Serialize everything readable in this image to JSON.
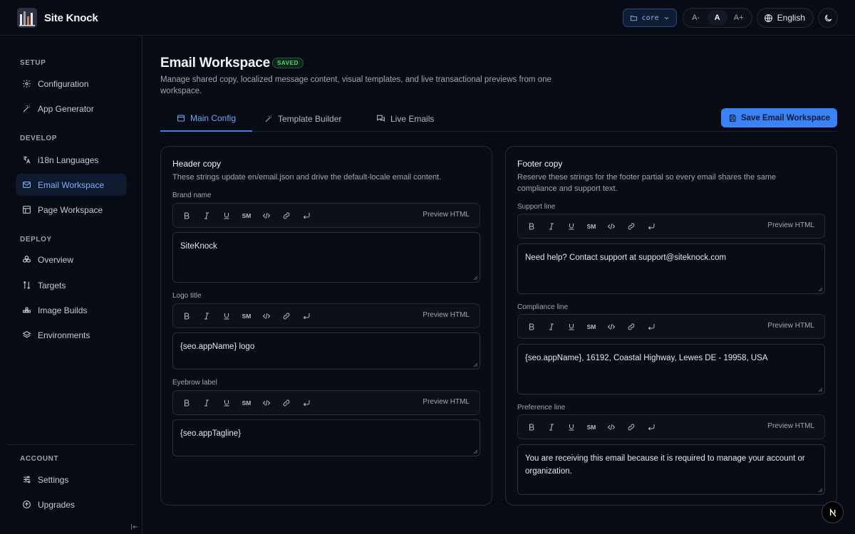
{
  "app": {
    "name": "Site Knock"
  },
  "topbar": {
    "env": "core",
    "font_decrease": "A-",
    "font_normal": "A",
    "font_increase": "A+",
    "language": "English"
  },
  "sidebar": {
    "sections": [
      {
        "title": "SETUP",
        "items": [
          {
            "label": "Configuration",
            "icon": "gear-icon"
          },
          {
            "label": "App Generator",
            "icon": "magic-wand-icon"
          }
        ]
      },
      {
        "title": "DEVELOP",
        "items": [
          {
            "label": "i18n Languages",
            "icon": "languages-icon"
          },
          {
            "label": "Email Workspace",
            "icon": "mail-icon",
            "active": true
          },
          {
            "label": "Page Workspace",
            "icon": "layout-icon"
          }
        ]
      },
      {
        "title": "DEPLOY",
        "items": [
          {
            "label": "Overview",
            "icon": "boxes-icon"
          },
          {
            "label": "Targets",
            "icon": "split-arrows-icon"
          },
          {
            "label": "Image Builds",
            "icon": "container-icon"
          },
          {
            "label": "Environments",
            "icon": "layers-icon"
          }
        ]
      },
      {
        "title": "ACCOUNT",
        "items": [
          {
            "label": "Settings",
            "icon": "sliders-icon"
          },
          {
            "label": "Upgrades",
            "icon": "arrow-up-circle-icon"
          }
        ]
      }
    ]
  },
  "page": {
    "title": "Email Workspace",
    "badge": "SAVED",
    "description": "Manage shared copy, localized message content, visual templates, and live transactional previews from one workspace.",
    "tabs": [
      {
        "label": "Main Config",
        "active": true
      },
      {
        "label": "Template Builder"
      },
      {
        "label": "Live Emails"
      }
    ],
    "save_button": "Save Email Workspace"
  },
  "toolbar": {
    "sm_label": "SM",
    "preview_label": "Preview HTML"
  },
  "header_card": {
    "title": "Header copy",
    "description": "These strings update en/email.json and drive the default-locale email content.",
    "fields": [
      {
        "label": "Brand name",
        "value": "SiteKnock"
      },
      {
        "label": "Logo title",
        "value": "{seo.appName} logo"
      },
      {
        "label": "Eyebrow label",
        "value": "{seo.appTagline}"
      }
    ]
  },
  "footer_card": {
    "title": "Footer copy",
    "description": "Reserve these strings for the footer partial so every email shares the same compliance and support text.",
    "fields": [
      {
        "label": "Support line",
        "value": "Need help? Contact support at support@siteknock.com"
      },
      {
        "label": "Compliance line",
        "value": "{seo.appName}, 16192, Coastal Highway, Lewes DE - 19958, USA"
      },
      {
        "label": "Preference line",
        "value": "You are receiving this email because it is required to manage your account or organization."
      }
    ]
  },
  "colors": {
    "accent": "#3b82f6",
    "background": "#070b14",
    "saved": "#4ade80"
  }
}
